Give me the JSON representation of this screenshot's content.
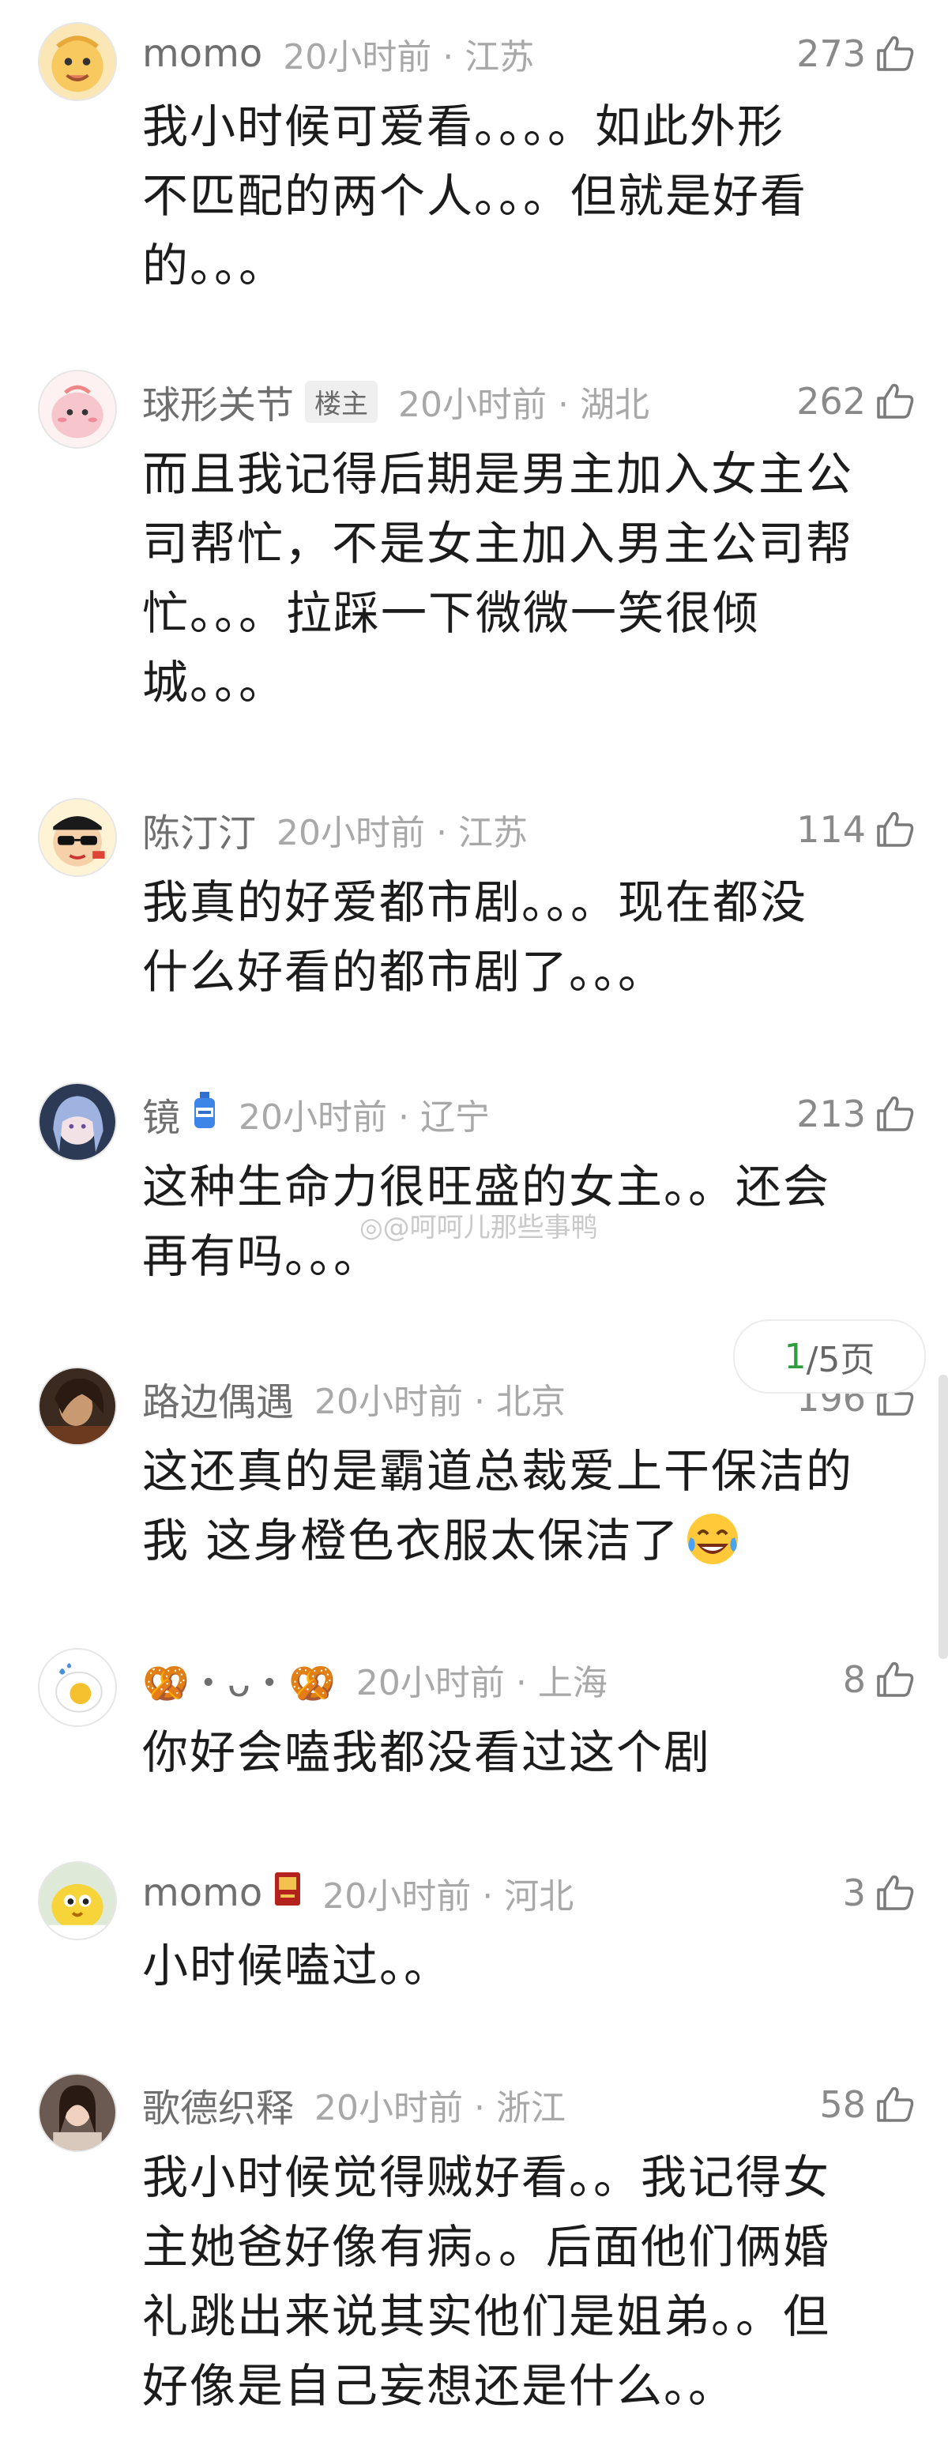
{
  "colors": {
    "accent_green": "#2e9c3f",
    "meta_gray": "#a8a8a8",
    "text_dark": "#1c1c1c"
  },
  "comments": [
    {
      "username": "momo",
      "time_location": "20小时前 · 江苏",
      "likes": "273",
      "lines": [
        "我小时候可爱看。。。。如此外形",
        "不匹配的两个人。。。但就是好看",
        "的。。。"
      ],
      "avatar": "cartoon-face"
    },
    {
      "username": "球形关节",
      "badge": "楼主",
      "time_location": "20小时前 · 湖北",
      "likes": "262",
      "lines": [
        "而且我记得后期是男主加入女主公",
        "司帮忙，不是女主加入男主公司帮",
        "忙。。。拉踩一下微微一笑很倾",
        "城。。。"
      ],
      "avatar": "pink-blob"
    },
    {
      "username": "陈汀汀",
      "time_location": "20小时前 · 江苏",
      "likes": "114",
      "lines": [
        "我真的好爱都市剧。。。现在都没",
        "什么好看的都市剧了。。。"
      ],
      "avatar": "sunglasses-cartoon"
    },
    {
      "username": "镜",
      "flair": "bottle-icon",
      "time_location": "20小时前 · 辽宁",
      "likes": "213",
      "lines": [
        "这种生命力很旺盛的女主。。还会",
        "再有吗。。。"
      ],
      "avatar": "anime-girl"
    },
    {
      "username": "路边偶遇",
      "time_location": "20小时前 · 北京",
      "likes": "196",
      "lines": [
        "这还真的是霸道总裁爱上干保洁的",
        "我 这身橙色衣服太保洁了"
      ],
      "emoji": "laughing-crying-emoji",
      "avatar": "photo-portrait"
    },
    {
      "username": "🥨・ᴗ・🥨",
      "time_location": "20小时前 · 上海",
      "likes": "8",
      "lines": [
        "你好会嗑我都没看过这个剧"
      ],
      "avatar": "egg-drop"
    },
    {
      "username": "momo",
      "flair": "red-medal-icon",
      "time_location": "20小时前 · 河北",
      "likes": "3",
      "lines": [
        "小时候嗑过。。"
      ],
      "avatar": "yellow-chick"
    },
    {
      "username": "歌德织释",
      "time_location": "20小时前 · 浙江",
      "likes": "58",
      "lines": [
        "我小时候觉得贼好看。。我记得女",
        "主她爸好像有病。。后面他们俩婚",
        "礼跳出来说其实他们是姐弟。。但",
        "好像是自己妄想还是什么。。"
      ],
      "avatar": "girl-photo"
    }
  ],
  "watermark": "@呵呵儿那些事鸭",
  "pager": {
    "current": "1",
    "rest": "/5页"
  }
}
